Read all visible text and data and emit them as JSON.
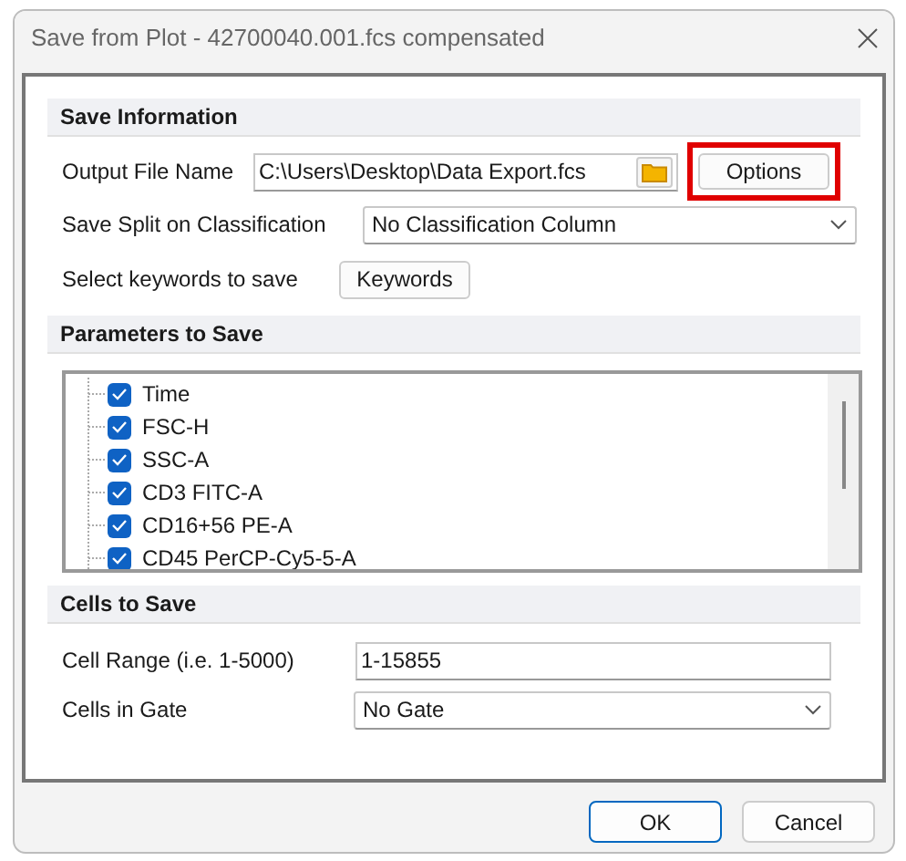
{
  "window": {
    "title": "Save from Plot - 42700040.001.fcs compensated"
  },
  "save_information": {
    "heading": "Save Information",
    "output_file": {
      "label": "Output File Name",
      "value": "C:\\Users\\Desktop\\Data Export.fcs",
      "options_button": "Options",
      "options_highlighted": true
    },
    "split": {
      "label": "Save Split on Classification",
      "value": "No Classification Column"
    },
    "keywords": {
      "label": "Select keywords to save",
      "button": "Keywords"
    }
  },
  "parameters": {
    "heading": "Parameters to Save",
    "items": [
      {
        "label": "Time",
        "checked": true
      },
      {
        "label": "FSC-H",
        "checked": true
      },
      {
        "label": "SSC-A",
        "checked": true
      },
      {
        "label": "CD3 FITC-A",
        "checked": true
      },
      {
        "label": "CD16+56 PE-A",
        "checked": true
      },
      {
        "label": "CD45 PerCP-Cy5-5-A",
        "checked": true
      }
    ]
  },
  "cells": {
    "heading": "Cells to Save",
    "range": {
      "label": "Cell Range (i.e. 1-5000)",
      "value": "1-15855"
    },
    "gate": {
      "label": "Cells in Gate",
      "value": "No Gate"
    }
  },
  "buttons": [
    {
      "label": "OK",
      "default": true
    },
    {
      "label": "Cancel",
      "default": false
    }
  ]
}
